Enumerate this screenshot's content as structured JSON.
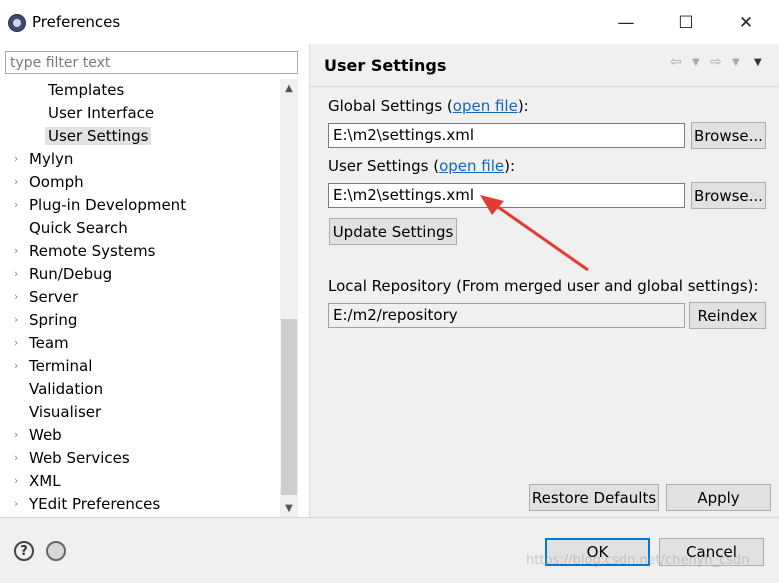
{
  "window": {
    "title": "Preferences",
    "minimize": "—",
    "maximize": "☐",
    "close": "✕"
  },
  "sidebar": {
    "filter_placeholder": "type filter text",
    "items": [
      {
        "label": "Templates",
        "level": 1
      },
      {
        "label": "User Interface",
        "level": 1
      },
      {
        "label": "User Settings",
        "level": 1,
        "selected": true
      },
      {
        "label": "Mylyn",
        "level": 0,
        "expandable": true
      },
      {
        "label": "Oomph",
        "level": 0,
        "expandable": true
      },
      {
        "label": "Plug-in Development",
        "level": 0,
        "expandable": true
      },
      {
        "label": "Quick Search",
        "level": 0
      },
      {
        "label": "Remote Systems",
        "level": 0,
        "expandable": true
      },
      {
        "label": "Run/Debug",
        "level": 0,
        "expandable": true
      },
      {
        "label": "Server",
        "level": 0,
        "expandable": true
      },
      {
        "label": "Spring",
        "level": 0,
        "expandable": true
      },
      {
        "label": "Team",
        "level": 0,
        "expandable": true
      },
      {
        "label": "Terminal",
        "level": 0,
        "expandable": true
      },
      {
        "label": "Validation",
        "level": 0
      },
      {
        "label": "Visualiser",
        "level": 0
      },
      {
        "label": "Web",
        "level": 0,
        "expandable": true
      },
      {
        "label": "Web Services",
        "level": 0,
        "expandable": true
      },
      {
        "label": "XML",
        "level": 0,
        "expandable": true
      },
      {
        "label": "YEdit Preferences",
        "level": 0,
        "expandable": true
      }
    ]
  },
  "main": {
    "title": "User Settings",
    "global_settings": {
      "label_prefix": "Global Settings (",
      "link": "open file",
      "label_suffix": "):",
      "value": "E:\\m2\\settings.xml",
      "browse": "Browse..."
    },
    "user_settings": {
      "label_prefix": "User Settings (",
      "link": "open file",
      "label_suffix": "):",
      "value": "E:\\m2\\settings.xml",
      "browse": "Browse..."
    },
    "update_settings": "Update Settings",
    "local_repo": {
      "label": "Local Repository (From merged user and global settings):",
      "value": "E:/m2/repository",
      "reindex": "Reindex"
    },
    "restore_defaults": "Restore Defaults",
    "apply": "Apply"
  },
  "footer": {
    "ok": "OK",
    "cancel": "Cancel",
    "watermark": "https://blog.csdn.net/chenyh_csdn"
  },
  "colors": {
    "link": "#1565c0",
    "arrow": "#e53935",
    "primary_border": "#0078d7"
  }
}
